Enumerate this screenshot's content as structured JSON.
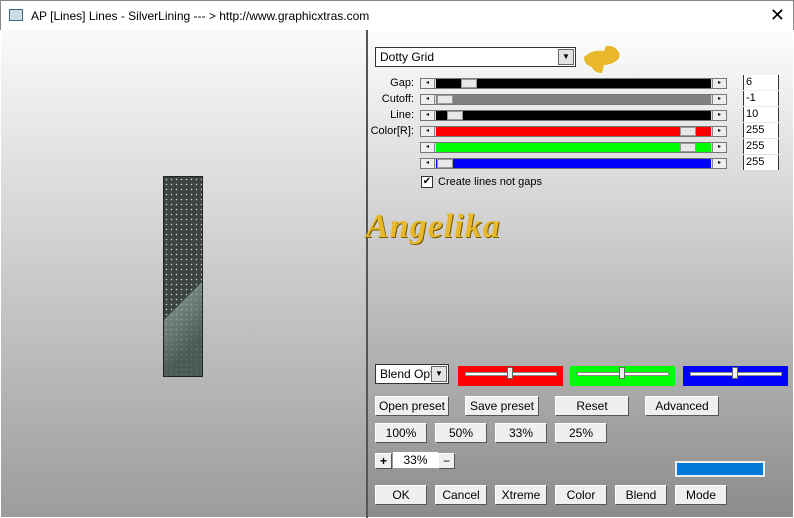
{
  "window": {
    "title": "AP [Lines]  Lines - SilverLining     --- > http://www.graphicxtras.com",
    "close": "✕"
  },
  "preset_dropdown": {
    "value": "Dotty Grid"
  },
  "sliders": [
    {
      "label": "Gap:",
      "value": "6",
      "position": 0.1,
      "color": "#000000"
    },
    {
      "label": "Cutoff:",
      "value": "-1",
      "position": 0.0,
      "color": "#808080"
    },
    {
      "label": "Line:",
      "value": "10",
      "position": 0.04,
      "color": "#000000"
    },
    {
      "label": "Color[R]:",
      "value": "255",
      "position": 1.0,
      "color": "#ff0000"
    },
    {
      "label": "",
      "value": "255",
      "position": 1.0,
      "color": "#00ff00"
    },
    {
      "label": "",
      "value": "255",
      "position": 0.0,
      "color": "#0000ff"
    }
  ],
  "checkbox": {
    "label": "Create lines not gaps",
    "checked": true
  },
  "watermark": "Angelika",
  "blend_dropdown": {
    "value": "Blend Opti"
  },
  "color_sliders": [
    {
      "color": "#ff0000",
      "position": 0.5
    },
    {
      "color": "#00ff00",
      "position": 0.5
    },
    {
      "color": "#0000ff",
      "position": 0.5
    }
  ],
  "buttons": {
    "open_preset": "Open preset",
    "save_preset": "Save preset",
    "reset": "Reset",
    "advanced": "Advanced",
    "z100": "100%",
    "z50": "50%",
    "z33": "33%",
    "z25": "25%",
    "plus": "+",
    "minus": "−",
    "zoom_value": "33%",
    "ok": "OK",
    "cancel": "Cancel",
    "xtreme": "Xtreme",
    "color": "Color",
    "blend": "Blend",
    "mode": "Mode"
  },
  "color_swatch": "#0078d7"
}
